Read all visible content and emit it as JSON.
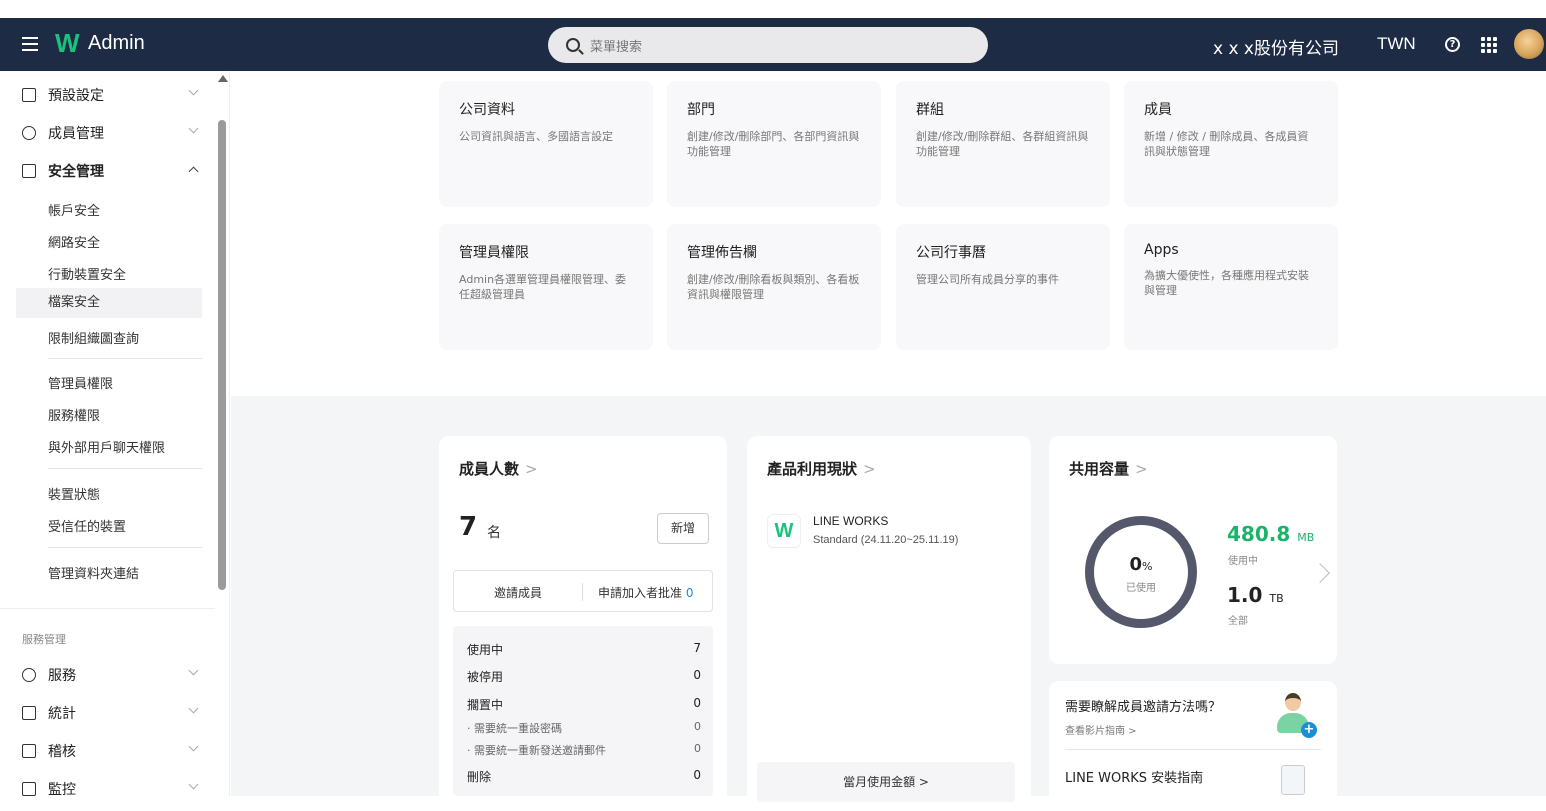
{
  "header": {
    "app_title": "Admin",
    "search_placeholder": "菜單搜索",
    "company": "x x x股份有公司",
    "country": "TWN"
  },
  "sidebar": {
    "top_items": [
      {
        "label": "預設設定"
      },
      {
        "label": "成員管理"
      },
      {
        "label": "安全管理"
      }
    ],
    "security_sub": [
      "帳戶安全",
      "網路安全",
      "行動裝置安全",
      "檔案安全",
      "限制組織圖查詢"
    ],
    "perm_sub": [
      "管理員權限",
      "服務權限",
      "與外部用戶聊天權限"
    ],
    "device_sub": [
      "裝置狀態",
      "受信任的裝置"
    ],
    "folder_sub": [
      "管理資料夾連結"
    ],
    "section_label": "服務管理",
    "service_items": [
      {
        "label": "服務"
      },
      {
        "label": "統計"
      },
      {
        "label": "稽核"
      },
      {
        "label": "監控"
      }
    ]
  },
  "tiles": [
    {
      "title": "公司資料",
      "desc": "公司資訊與語言、多國語言設定"
    },
    {
      "title": "部門",
      "desc": "創建/修改/刪除部門、各部門資訊與功能管理"
    },
    {
      "title": "群組",
      "desc": "創建/修改/刪除群組、各群組資訊與功能管理"
    },
    {
      "title": "成員",
      "desc": "新增 / 修改 / 刪除成員、各成員資訊與狀態管理"
    },
    {
      "title": "管理員權限",
      "desc": "Admin各選單管理員權限管理、委任超級管理員"
    },
    {
      "title": "管理佈告欄",
      "desc": "創建/修改/刪除看板與類別、各看板資訊與權限管理"
    },
    {
      "title": "公司行事曆",
      "desc": "管理公司所有成員分享的事件"
    },
    {
      "title": "Apps",
      "desc": "為擴大優使性，各種應用程式安裝與管理"
    }
  ],
  "members_card": {
    "title": "成員人數",
    "count": "7",
    "unit": "名",
    "add_label": "新增",
    "invite_label": "邀請成員",
    "requests_label": "申請加入者批准",
    "requests_count": "0",
    "rows": [
      {
        "label": "使用中",
        "value": "7"
      },
      {
        "label": "被停用",
        "value": "0"
      },
      {
        "label": "擱置中",
        "value": "0"
      },
      {
        "label": "· 需要統一重設密碼",
        "value": "0"
      },
      {
        "label": "· 需要統一重新發送邀請郵件",
        "value": "0"
      },
      {
        "label": "刪除",
        "value": "0"
      }
    ]
  },
  "product_card": {
    "title": "產品利用現狀",
    "product_name": "LINE WORKS",
    "plan": "Standard (24.11.20~25.11.19)",
    "monthly_label": "當月使用金額 >"
  },
  "storage_card": {
    "title": "共用容量",
    "used_percent": "0",
    "percent_sign": "%",
    "used_caption": "已使用",
    "used_value": "480.8",
    "used_unit": "MB",
    "used_label": "使用中",
    "total_value": "1.0",
    "total_unit": "TB",
    "total_label": "全部"
  },
  "help_card": {
    "title": "需要瞭解成員邀請方法嗎？",
    "link": "查看影片指南 >",
    "guide_title": "LINE WORKS 安裝指南"
  },
  "colors": {
    "header_bg": "#1d2b45",
    "accent_green": "#19b36a",
    "link_blue": "#1a8fd8"
  }
}
